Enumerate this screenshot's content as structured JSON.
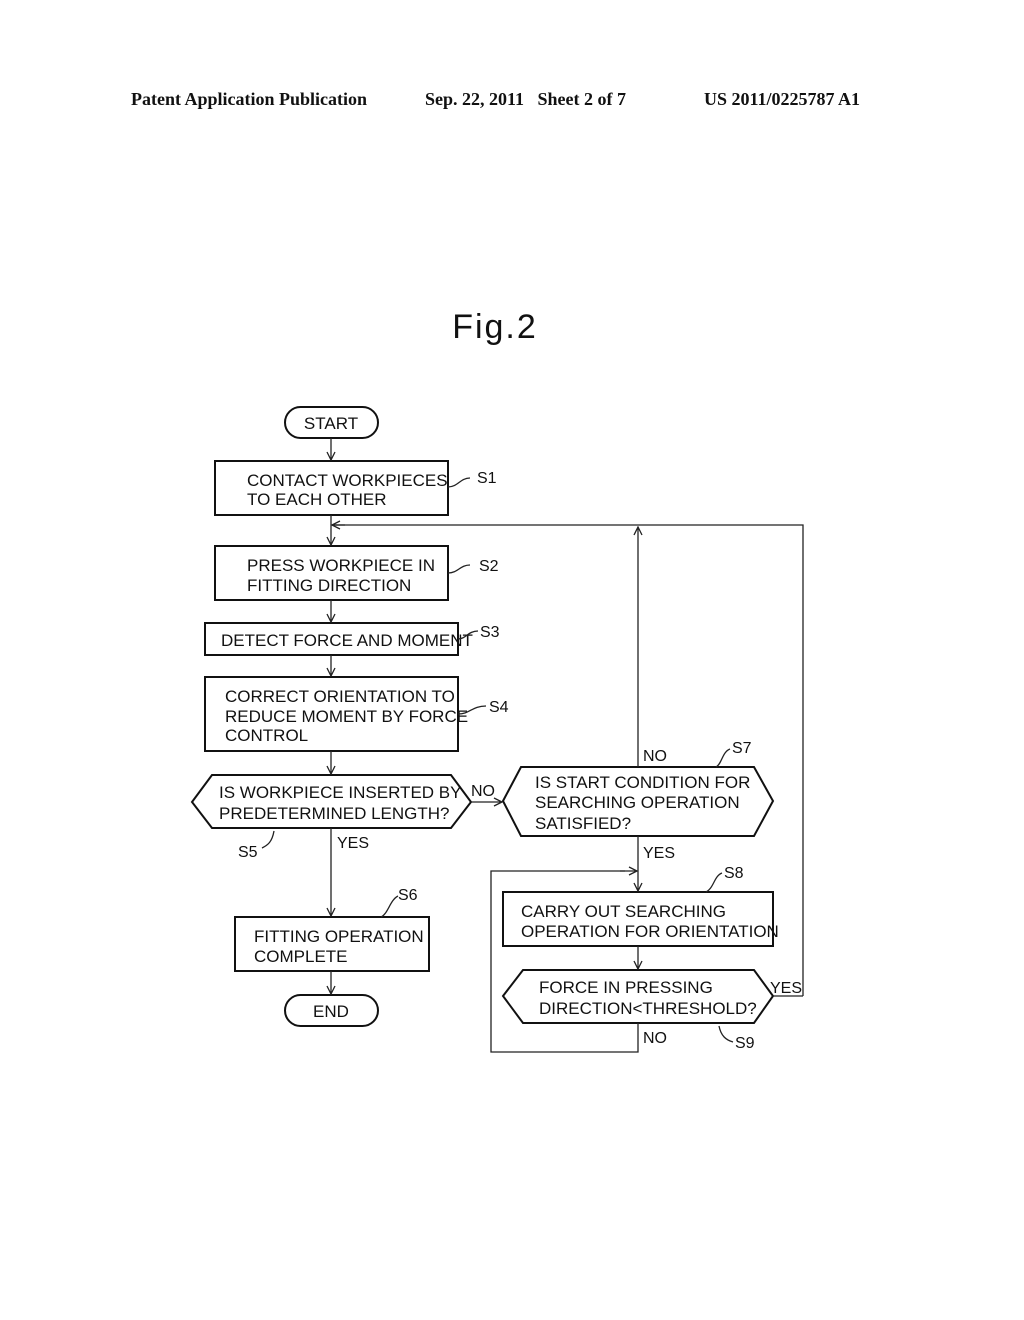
{
  "header": {
    "publication": "Patent Application Publication",
    "date_sheet": "Sep. 22, 2011   Sheet 2 of 7",
    "patent_number": "US 2011/0225787 A1"
  },
  "figure": {
    "title": "Fig.2"
  },
  "flowchart": {
    "start": "START",
    "end": "END",
    "steps": {
      "s1": {
        "id": "S1",
        "lines": [
          "CONTACT WORKPIECES",
          "TO EACH OTHER"
        ]
      },
      "s2": {
        "id": "S2",
        "lines": [
          "PRESS WORKPIECE IN",
          "FITTING DIRECTION"
        ]
      },
      "s3": {
        "id": "S3",
        "lines": [
          "DETECT FORCE AND MOMENT"
        ]
      },
      "s4": {
        "id": "S4",
        "lines": [
          "CORRECT ORIENTATION TO",
          "REDUCE MOMENT BY FORCE",
          "CONTROL"
        ]
      },
      "s5": {
        "id": "S5",
        "lines": [
          "IS WORKPIECE INSERTED BY",
          "PREDETERMINED LENGTH?"
        ]
      },
      "s6": {
        "id": "S6",
        "lines": [
          "FITTING OPERATION",
          "COMPLETE"
        ]
      },
      "s7": {
        "id": "S7",
        "lines": [
          "IS START CONDITION FOR",
          "SEARCHING OPERATION",
          "SATISFIED?"
        ]
      },
      "s8": {
        "id": "S8",
        "lines": [
          "CARRY OUT SEARCHING",
          "OPERATION FOR ORIENTATION"
        ]
      },
      "s9": {
        "id": "S9",
        "lines": [
          "FORCE IN PRESSING",
          "DIRECTION<THRESHOLD?"
        ]
      }
    },
    "branch_labels": {
      "s5_no": "NO",
      "s5_yes": "YES",
      "s7_no": "NO",
      "s7_yes": "YES",
      "s9_yes": "YES",
      "s9_no": "NO"
    }
  }
}
